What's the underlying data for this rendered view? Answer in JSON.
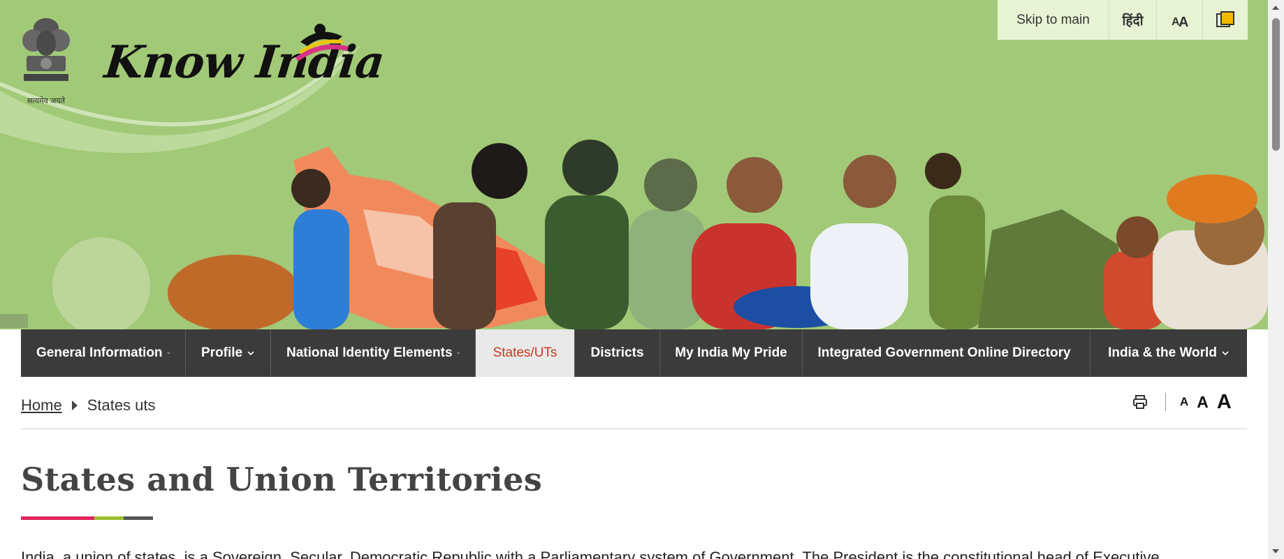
{
  "header": {
    "emblem_motto": "सत्यमेव जयते",
    "logo_text": "Know India"
  },
  "util_bar": {
    "skip_label": "Skip to main",
    "hindi_label": "हिंदी",
    "font_icon": "font-size-icon",
    "contrast_icon": "contrast-icon"
  },
  "nav": {
    "items": [
      {
        "label": "General Information",
        "dropdown": true
      },
      {
        "label": "Profile",
        "dropdown": true
      },
      {
        "label": "National Identity Elements",
        "dropdown": true
      },
      {
        "label": "States/UTs",
        "dropdown": false,
        "active": true
      },
      {
        "label": "Districts",
        "dropdown": false
      },
      {
        "label": "My India My Pride",
        "dropdown": false
      },
      {
        "label": "Integrated Government Online Directory",
        "dropdown": true
      },
      {
        "label": "India & the World",
        "dropdown": true
      }
    ]
  },
  "breadcrumb": {
    "home": "Home",
    "current": "States uts"
  },
  "tools": {
    "print_icon": "print-icon",
    "font_small": "A",
    "font_medium": "A",
    "font_large": "A"
  },
  "main": {
    "title": "States and Union Territories",
    "intro": "India, a union of states, is a Sovereign, Secular, Democratic Republic with a Parliamentary system of Government. The President is the constitutional head of Executive"
  },
  "colors": {
    "banner_bg": "#a1c977",
    "nav_bg": "#3b3b3b",
    "nav_active_text": "#c63a1f",
    "title_bar": [
      "#e0245e",
      "#9bbf2f",
      "#555555"
    ]
  }
}
